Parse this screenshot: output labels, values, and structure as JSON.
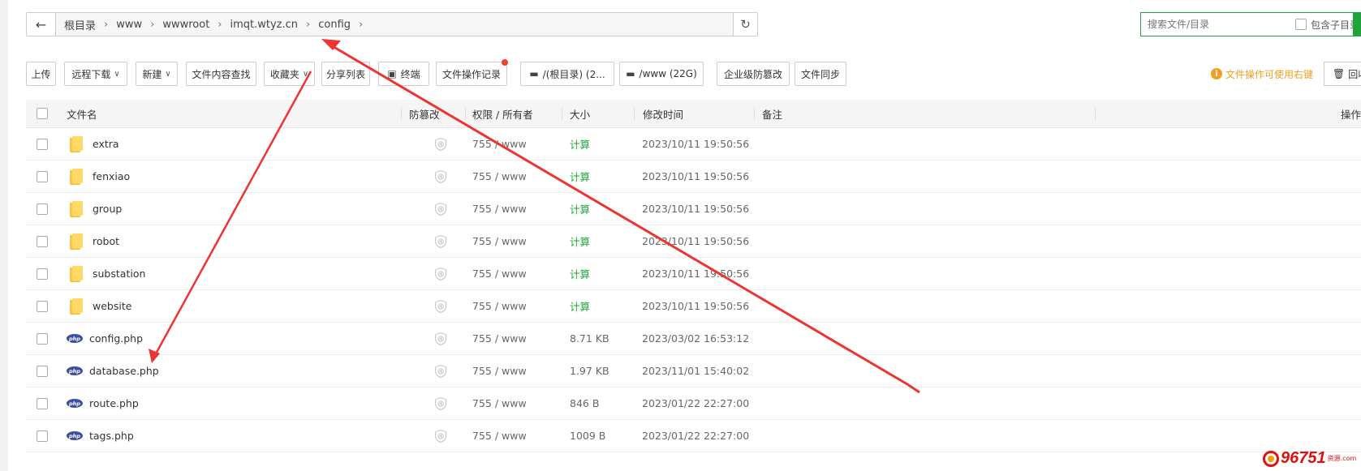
{
  "breadcrumb": {
    "back_icon": "arrow-left-icon",
    "items": [
      "根目录",
      "www",
      "wwwroot",
      "imqt.wtyz.cn",
      "config"
    ],
    "separator": "›",
    "refresh_icon": "refresh-icon"
  },
  "search": {
    "placeholder": "搜索文件/目录",
    "include_sub_label": "包含子目录"
  },
  "toolbar": {
    "upload": "上传",
    "remote_download": "远程下载",
    "new": "新建",
    "content_search": "文件内容查找",
    "favorites": "收藏夹",
    "share_list": "分享列表",
    "terminal": "终端",
    "op_log": "文件操作记录",
    "disk_root": "/(根目录) (2...",
    "disk_www": "/www (22G)",
    "tamper_proof": "企业级防篡改",
    "file_sync": "文件同步",
    "tip": "文件操作可使用右键",
    "recycle": "回收站"
  },
  "table": {
    "headers": {
      "name": "文件名",
      "protect": "防篡改",
      "perm": "权限 / 所有者",
      "size": "大小",
      "mtime": "修改时间",
      "note": "备注",
      "op": "操作"
    },
    "rows": [
      {
        "type": "folder",
        "name": "extra",
        "perm": "755 / www",
        "size": "计算",
        "mtime": "2023/10/11 19:50:56"
      },
      {
        "type": "folder",
        "name": "fenxiao",
        "perm": "755 / www",
        "size": "计算",
        "mtime": "2023/10/11 19:50:56"
      },
      {
        "type": "folder",
        "name": "group",
        "perm": "755 / www",
        "size": "计算",
        "mtime": "2023/10/11 19:50:56"
      },
      {
        "type": "folder",
        "name": "robot",
        "perm": "755 / www",
        "size": "计算",
        "mtime": "2023/10/11 19:50:56"
      },
      {
        "type": "folder",
        "name": "substation",
        "perm": "755 / www",
        "size": "计算",
        "mtime": "2023/10/11 19:50:56"
      },
      {
        "type": "folder",
        "name": "website",
        "perm": "755 / www",
        "size": "计算",
        "mtime": "2023/10/11 19:50:56"
      },
      {
        "type": "php",
        "name": "config.php",
        "perm": "755 / www",
        "size": "8.71 KB",
        "mtime": "2023/03/02 16:53:12"
      },
      {
        "type": "php",
        "name": "database.php",
        "perm": "755 / www",
        "size": "1.97 KB",
        "mtime": "2023/11/01 15:40:02"
      },
      {
        "type": "php",
        "name": "route.php",
        "perm": "755 / www",
        "size": "846 B",
        "mtime": "2023/01/22 22:27:00"
      },
      {
        "type": "php",
        "name": "tags.php",
        "perm": "755 / www",
        "size": "1009 B",
        "mtime": "2023/01/22 22:27:00"
      }
    ]
  },
  "icons": {
    "folder": "folder-icon",
    "php": "php-file-icon",
    "shield": "shield-icon"
  },
  "php_badge": "php",
  "watermark": {
    "number": "96751",
    "suffix": "资源.com"
  },
  "colors": {
    "accent_green": "#20a53a",
    "annotation_red": "#ee3333",
    "tip_orange": "#f0a020"
  }
}
